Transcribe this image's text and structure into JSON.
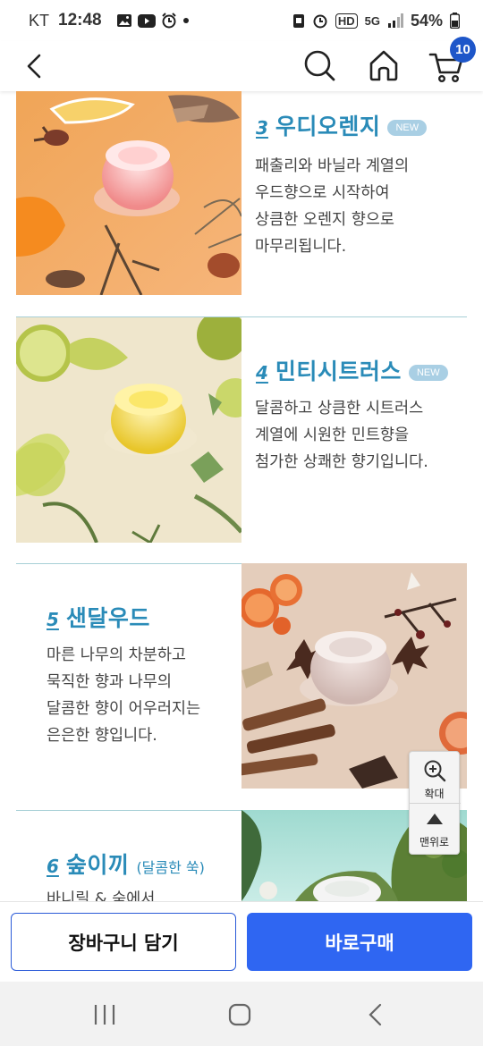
{
  "status_bar": {
    "carrier": "KT",
    "time": "12:48",
    "hd": "HD",
    "network": "5G",
    "battery": "54%"
  },
  "header": {
    "cart_count": "10"
  },
  "products": [
    {
      "number": "3",
      "name": "우디오렌지",
      "badge": "NEW",
      "description": "패출리와 바닐라 계열의\n우드향으로 시작하여\n상큼한 오렌지 향으로\n마무리됩니다."
    },
    {
      "number": "4",
      "name": "민티시트러스",
      "badge": "NEW",
      "description": "달콤하고 상큼한 시트러스\n계열에 시원한 민트향을\n첨가한 상쾌한 향기입니다."
    },
    {
      "number": "5",
      "name": "샌달우드",
      "description": "마른 나무의 차분하고\n묵직한 향과 나무의\n달콤한 향이 어우러지는\n은은한 향입니다."
    },
    {
      "number": "6",
      "name": "숲이끼",
      "note": "(달콤한 쑥)",
      "description": "바니릴 & 숲에서"
    }
  ],
  "float_tools": {
    "zoom_label": "확대",
    "top_label": "맨위로"
  },
  "actions": {
    "cart_label": "장바구니 담기",
    "buy_label": "바로구매"
  },
  "colors": {
    "accent": "#2a8bb8",
    "buy_button": "#2f66f2",
    "badge": "#1e56c9"
  }
}
